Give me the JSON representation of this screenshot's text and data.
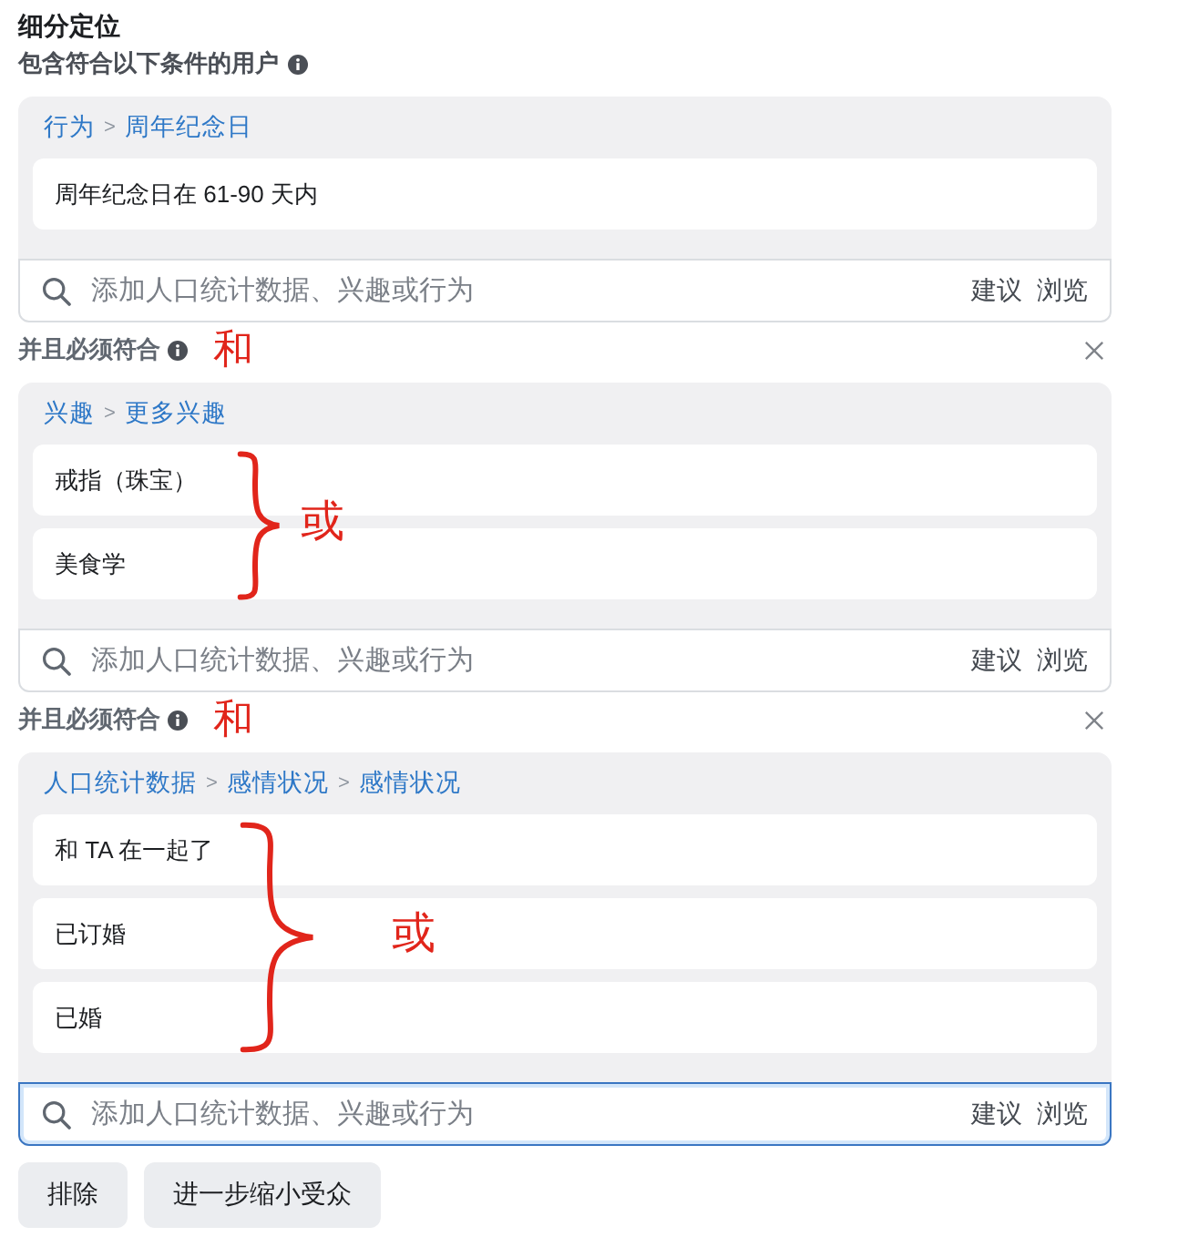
{
  "title": "细分定位",
  "subtitle": "包含符合以下条件的用户",
  "groups": [
    {
      "breadcrumb": [
        {
          "kind": "link",
          "text": "行为"
        },
        {
          "kind": "separator",
          "text": ">"
        },
        {
          "kind": "link",
          "text": "周年纪念日"
        }
      ],
      "items": [
        "周年纪念日在 61-90 天内"
      ],
      "search": {
        "placeholder": "添加人口统计数据、兴趣或行为",
        "actions": [
          "建议",
          "浏览"
        ],
        "focused": false
      }
    },
    {
      "header": "并且必须符合",
      "and_note": "和",
      "or_note": "或",
      "breadcrumb": [
        {
          "kind": "link",
          "text": "兴趣"
        },
        {
          "kind": "separator",
          "text": ">"
        },
        {
          "kind": "link",
          "text": "更多兴趣"
        }
      ],
      "items": [
        "戒指（珠宝）",
        "美食学"
      ],
      "search": {
        "placeholder": "添加人口统计数据、兴趣或行为",
        "actions": [
          "建议",
          "浏览"
        ],
        "focused": false
      }
    },
    {
      "header": "并且必须符合",
      "and_note": "和",
      "or_note": "或",
      "breadcrumb": [
        {
          "kind": "link",
          "text": "人口统计数据"
        },
        {
          "kind": "separator",
          "text": ">"
        },
        {
          "kind": "link",
          "text": "感情状况"
        },
        {
          "kind": "separator",
          "text": ">"
        },
        {
          "kind": "link",
          "text": "感情状况"
        }
      ],
      "items": [
        "和 TA 在一起了",
        "已订婚",
        "已婚"
      ],
      "search": {
        "placeholder": "添加人口统计数据、兴趣或行为",
        "actions": [
          "建议",
          "浏览"
        ],
        "focused": true
      }
    }
  ],
  "buttons": [
    "排除",
    "进一步缩小受众"
  ]
}
